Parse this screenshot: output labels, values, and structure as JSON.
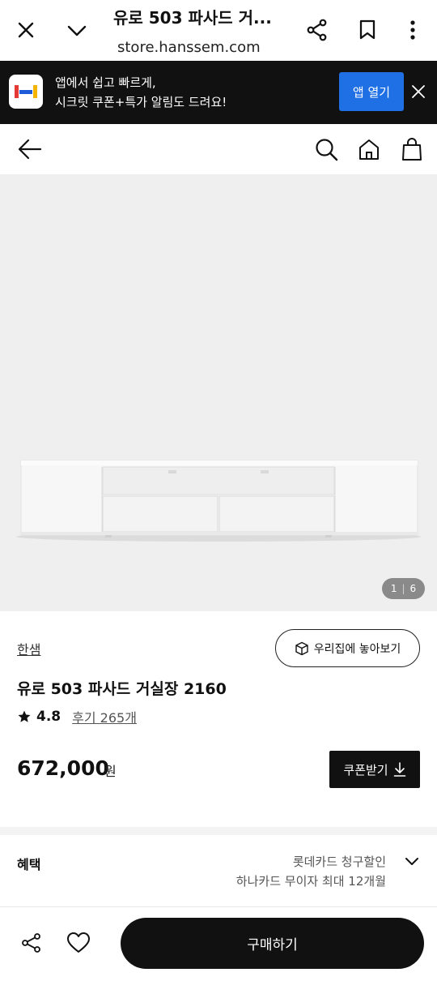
{
  "browser": {
    "title": "유로 503 파사드 거...",
    "url": "store.hanssem.com"
  },
  "app_banner": {
    "line1": "앱에서 쉽고 빠르게,",
    "line2": "시크릿 쿠폰+특가 알림도 드려요!",
    "open_label": "앱 열기"
  },
  "product": {
    "image_counter": {
      "current": "1",
      "separator": "|",
      "total": "6"
    },
    "brand": "한샘",
    "ar_label": "우리집에 놓아보기",
    "name": "유로 503 파사드 거실장 2160",
    "rating": "4.8",
    "review_label": "후기 265개",
    "price": "672,000",
    "price_unit": "원",
    "coupon_label": "쿠폰받기"
  },
  "benefits": {
    "label": "혜택",
    "items": [
      "롯데카드 청구할인",
      "하나카드 무이자 최대 12개월"
    ]
  },
  "bottom_bar": {
    "buy_label": "구매하기"
  },
  "colors": {
    "banner_bg": "#111111",
    "open_button": "#1f6fe5",
    "buy_button": "#111111",
    "image_bg": "#efefef"
  }
}
